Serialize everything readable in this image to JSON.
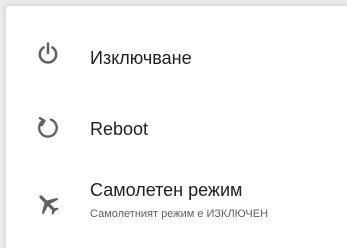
{
  "power_menu": {
    "items": [
      {
        "label": "Изключване",
        "icon": "power-icon"
      },
      {
        "label": "Reboot",
        "icon": "restart-icon"
      },
      {
        "label": "Самолетен режим",
        "sublabel": "Самолетният режим е ИЗКЛЮЧЕН",
        "icon": "airplane-icon"
      }
    ],
    "icon_color": "#616161",
    "text_color": "#212121"
  }
}
